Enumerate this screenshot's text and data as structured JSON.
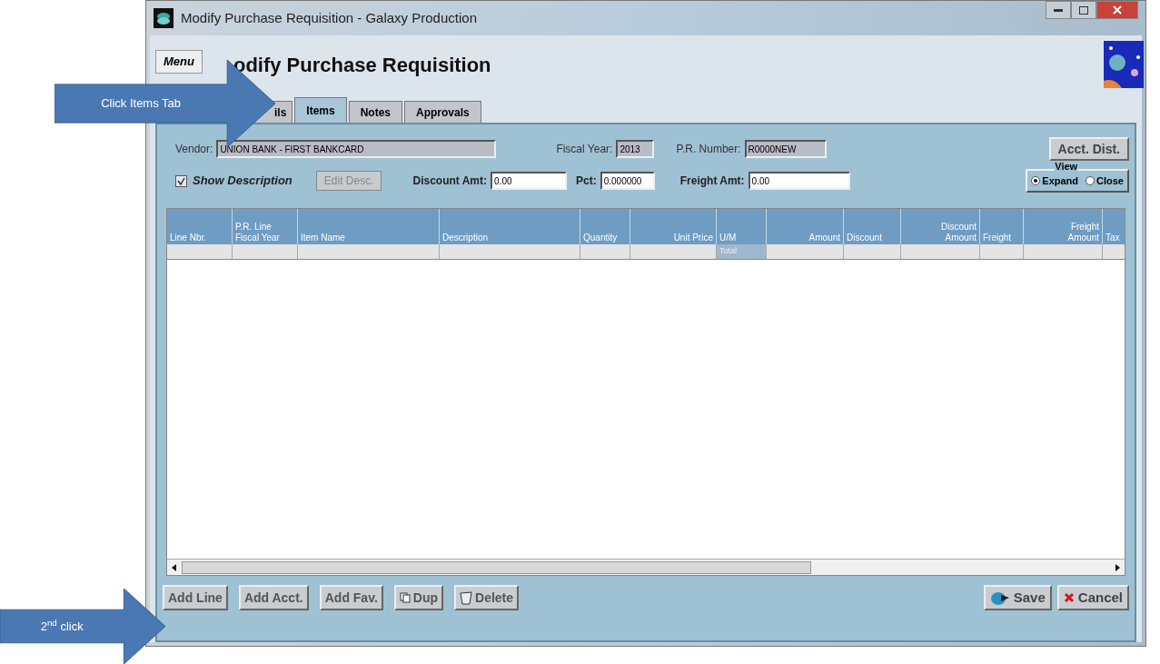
{
  "window": {
    "title": "Modify Purchase Requisition - Galaxy Production"
  },
  "menu_button": "Menu",
  "page_title": "odify Purchase Requisition",
  "tabs": [
    {
      "label": "ils",
      "selected": false
    },
    {
      "label": "Items",
      "selected": true
    },
    {
      "label": "Notes",
      "selected": false
    },
    {
      "label": "Approvals",
      "selected": false
    }
  ],
  "vendor": {
    "label": "Vendor:",
    "value": "UNION BANK - FIRST BANKCARD"
  },
  "fiscal_year": {
    "label": "Fiscal Year:",
    "value": "2013"
  },
  "pr_number": {
    "label": "P.R. Number:",
    "value": "R0000NEW"
  },
  "acct_dist_button": "Acct. Dist.",
  "show_description": {
    "label": "Show Description",
    "checked": true
  },
  "edit_desc_button": {
    "label": "Edit Desc.",
    "disabled": true
  },
  "discount_amt": {
    "label": "Discount Amt:",
    "value": "0.00"
  },
  "pct": {
    "label": "Pct:",
    "value": "0.000000"
  },
  "freight_amt": {
    "label": "Freight Amt:",
    "value": "0.00"
  },
  "view": {
    "label": "View",
    "options": [
      {
        "label": "Expand",
        "selected": true
      },
      {
        "label": "Close",
        "selected": false
      }
    ]
  },
  "grid": {
    "columns": [
      "Line Nbr.",
      "P.R. Line\nFiscal Year",
      "Item Name",
      "Description",
      "Quantity",
      "Unit Price",
      "U/M",
      "Amount",
      "Discount",
      "Discount\nAmount",
      "Freight",
      "Freight\nAmount",
      "Tax"
    ],
    "total_label": "Total"
  },
  "left_buttons": [
    "Add Line",
    "Add Acct.",
    "Add Fav.",
    "Dup",
    "Delete"
  ],
  "right_buttons": [
    "Save",
    "Cancel"
  ],
  "callouts": [
    "Click Items Tab",
    "2$^{nd}$ click"
  ]
}
